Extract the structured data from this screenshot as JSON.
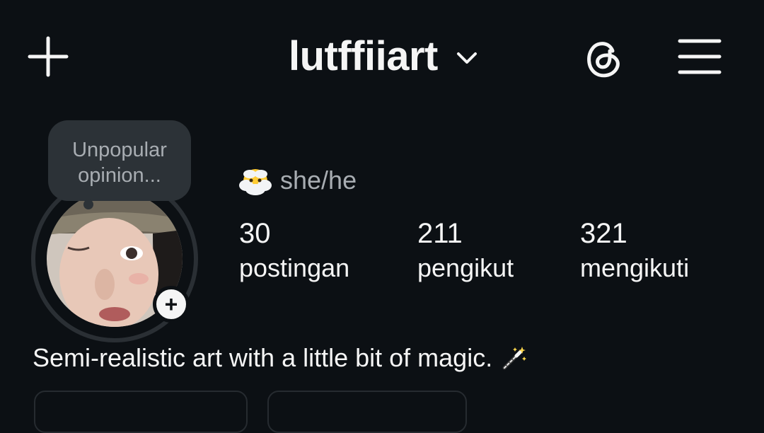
{
  "header": {
    "username": "lutffiiart"
  },
  "note": {
    "line1": "Unpopular",
    "line2": "opinion..."
  },
  "profile": {
    "pronouns": "she/he"
  },
  "stats": [
    {
      "value": "30",
      "label": "postingan"
    },
    {
      "value": "211",
      "label": "pengikut"
    },
    {
      "value": "321",
      "label": "mengikuti"
    }
  ],
  "bio": {
    "text": "Semi-realistic art with a little bit of magic."
  },
  "add_story_symbol": "+",
  "icons": {
    "create": "plus-icon",
    "switch_account": "chevron-down-icon",
    "threads": "threads-icon",
    "menu": "hamburger-menu-icon",
    "pronoun_emoji": "face-in-clouds-emoji",
    "bio_emoji": "magic-wand-emoji"
  },
  "colors": {
    "background": "#0c1014",
    "text_primary": "#f5f5f5",
    "text_secondary": "#a8adb2",
    "bubble": "#2c3237"
  }
}
